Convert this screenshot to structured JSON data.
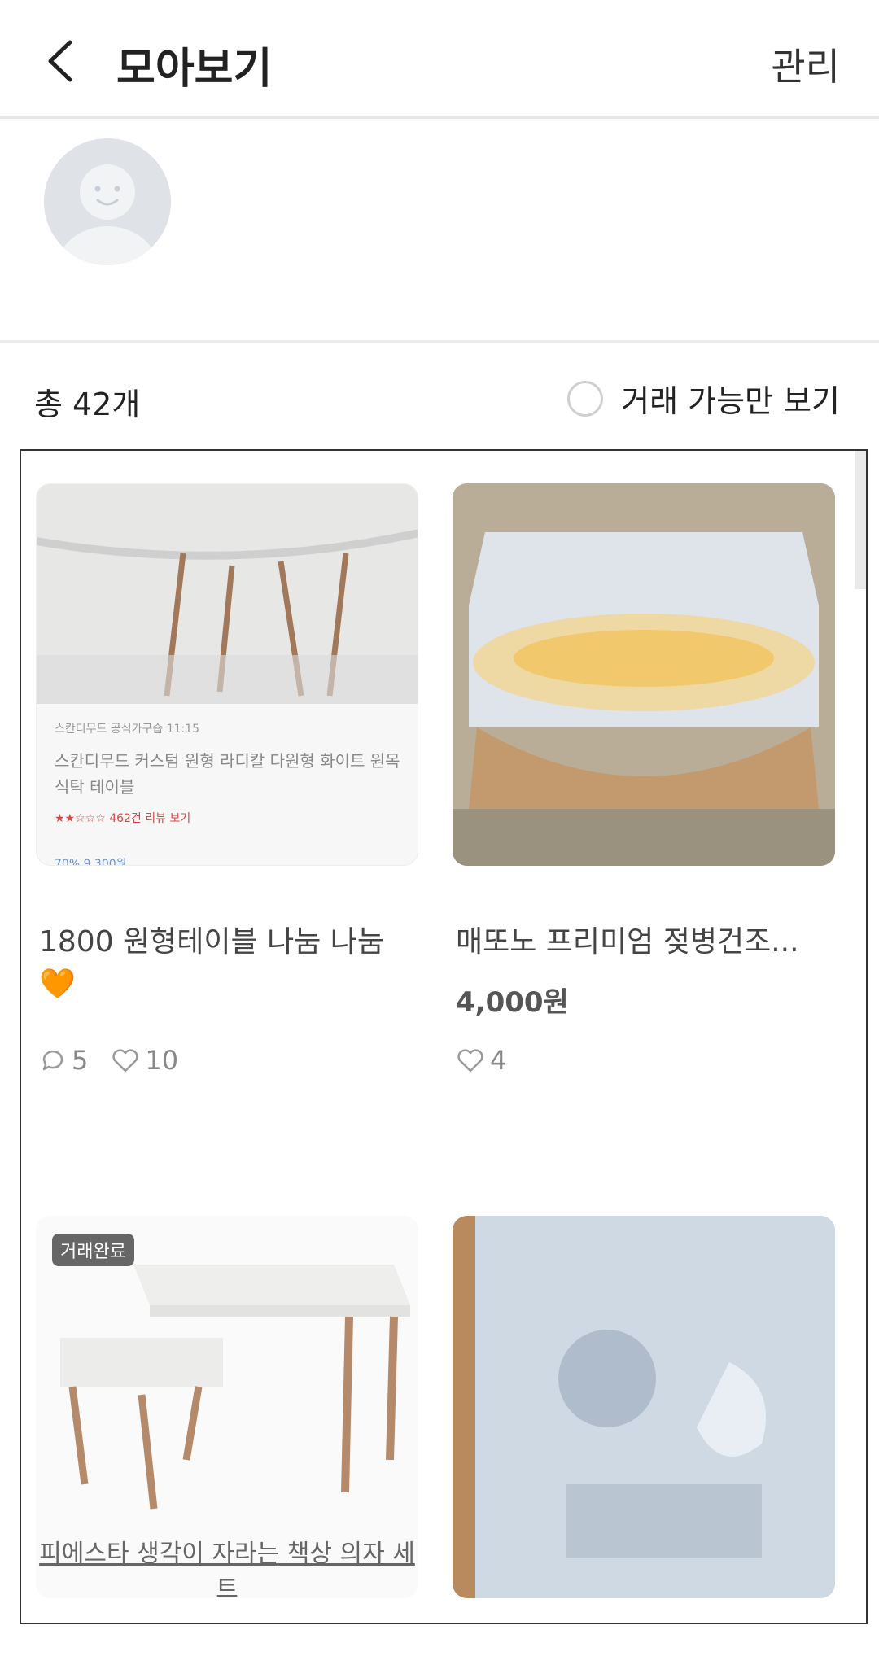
{
  "header": {
    "title": "모아보기",
    "manage_label": "관리"
  },
  "list": {
    "count_label": "총 42개",
    "filter_label": "거래 가능만 보기"
  },
  "items": [
    {
      "title": "1800 원형테이블 나눔 나눔🧡",
      "price": "",
      "chat_count": "5",
      "like_count": "10",
      "ad_lines": [
        "스칸디무드 공식가구숍 11:15",
        "스칸디무드 커스텀 원형 라디칼 다원형 화이트 원목 식탁 테이블",
        "★★☆☆☆ 462건 리뷰 보기",
        "70% 9,300원"
      ]
    },
    {
      "title": "매또노 프리미엄 젖병건조...",
      "price": "4,000원",
      "like_count": "4"
    },
    {
      "badge": "거래완료",
      "caption": "피에스타 생각이 자라는 책상 의자 세트"
    },
    {
      "title": ""
    }
  ]
}
